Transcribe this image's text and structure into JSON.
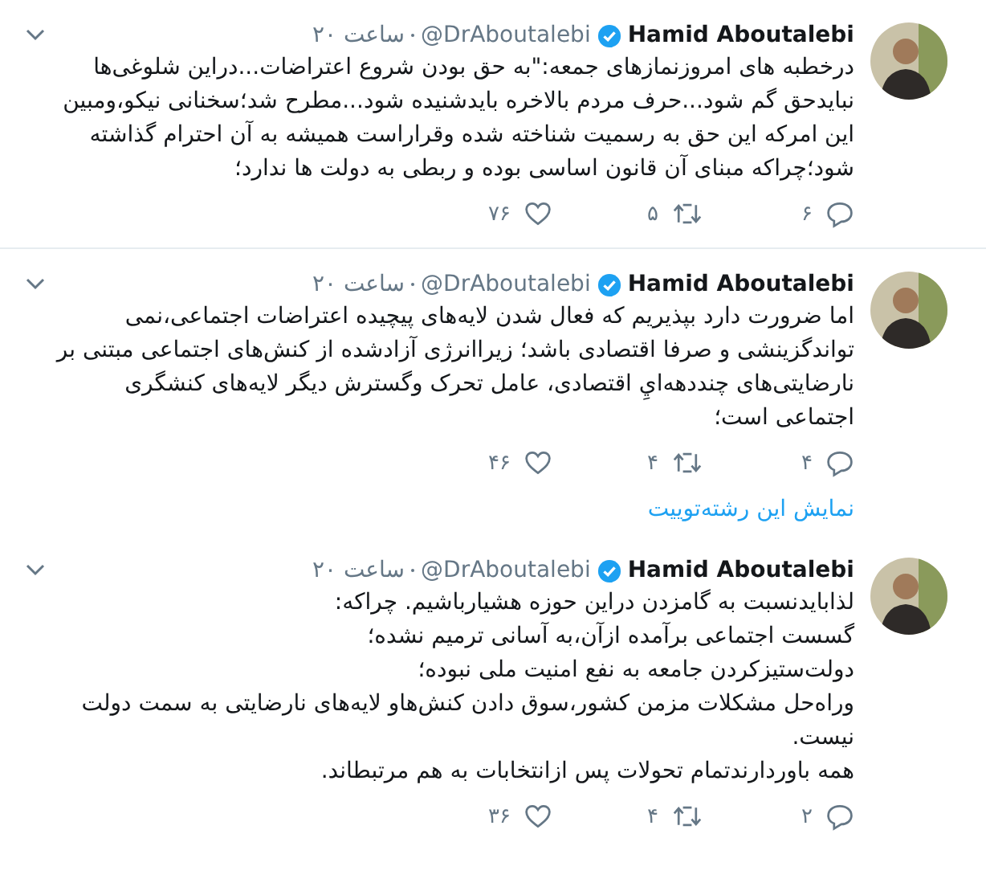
{
  "tweets": [
    {
      "name": "Hamid Aboutalebi",
      "verified": true,
      "handle": "@DrAboutalebi",
      "time": "۲۰ ساعت",
      "text": "درخطبه های امروزنمازهای جمعه:\"به حق بودن شروع اعتراضات...دراین شلوغی‌ها نبایدحق گم شود...حرف مردم بالاخره بایدشنیده شود...مطرح شد؛سخنانی نیکو،ومبین این امرکه این حق به رسمیت شناخته شده وقراراست همیشه به آن احترام گذاشته شود؛چراکه مبنای آن قانون اساسی بوده و ربطی به دولت ها ندارد؛",
      "replies": "۶",
      "retweets": "۵",
      "likes": "۷۶"
    },
    {
      "name": "Hamid Aboutalebi",
      "verified": true,
      "handle": "@DrAboutalebi",
      "time": "۲۰ ساعت",
      "text": "اما ضرورت دارد بپذیریم که فعال شدن لایه‌های پیچیده اعتراضات اجتماعی،نمی تواندگزینشی و صرفا اقتصادی باشد؛ زیراانرژی آزادشده از کنش‌های اجتماعی مبتنی بر نارضایتی‌های چنددهه‌ايِ اقتصادی، عامل تحرک وگسترش دیگر لایه‌های کنشگری اجتماعی است؛",
      "replies": "۴",
      "retweets": "۴",
      "likes": "۴۶",
      "thread_link": "نمایش این رشته‌توییت"
    },
    {
      "name": "Hamid Aboutalebi",
      "verified": true,
      "handle": "@DrAboutalebi",
      "time": "۲۰ ساعت",
      "text": "لذابایدنسبت به گامزدن دراین حوزه هشیارباشیم. چراکه:\nگسست اجتماعی برآمده ازآن،به آسانی ترمیم نشده؛\nدولت‌ستیزکردن جامعه به نفع امنیت ملی نبوده؛\nوراه‌حل مشکلات مزمن کشور،سوق دادن کنش‌هاو لایه‌های نارضایتی به سمت دولت نیست.\nهمه باوردارندتمام تحولات پس ازانتخابات به هم مرتبطاند.",
      "replies": "۲",
      "retweets": "۴",
      "likes": "۳۶"
    }
  ]
}
